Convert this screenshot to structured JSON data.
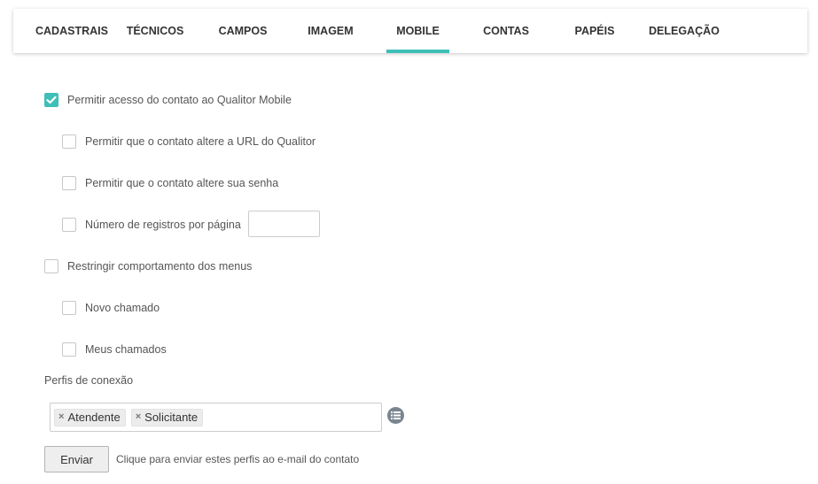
{
  "tabs": [
    {
      "label": "CADASTRAIS"
    },
    {
      "label": "TÉCNICOS"
    },
    {
      "label": "CAMPOS"
    },
    {
      "label": "IMAGEM"
    },
    {
      "label": "MOBILE",
      "active": true
    },
    {
      "label": "CONTAS"
    },
    {
      "label": "PAPÉIS"
    },
    {
      "label": "DELEGAÇÃO"
    }
  ],
  "accent_color": "#3ebfb8",
  "mobile": {
    "allow_access": {
      "label": "Permitir acesso do contato ao Qualitor Mobile",
      "checked": true
    },
    "allow_url_change": {
      "label": "Permitir que o contato altere a URL do Qualitor",
      "checked": false
    },
    "allow_password_change": {
      "label": "Permitir que o contato altere sua senha",
      "checked": false
    },
    "records_per_page": {
      "label": "Número de registros por página",
      "checked": false,
      "value": ""
    },
    "restrict_menus": {
      "label": "Restringir comportamento dos menus",
      "checked": false
    },
    "new_ticket": {
      "label": "Novo chamado",
      "checked": false
    },
    "my_tickets": {
      "label": "Meus chamados",
      "checked": false
    }
  },
  "profiles": {
    "label": "Perfis de conexão",
    "tags": [
      "Atendente",
      "Solicitante"
    ],
    "remove_glyph": "×",
    "list_icon": "list-icon"
  },
  "send": {
    "button_label": "Enviar",
    "hint": "Clique para enviar estes perfis ao e-mail do contato"
  }
}
